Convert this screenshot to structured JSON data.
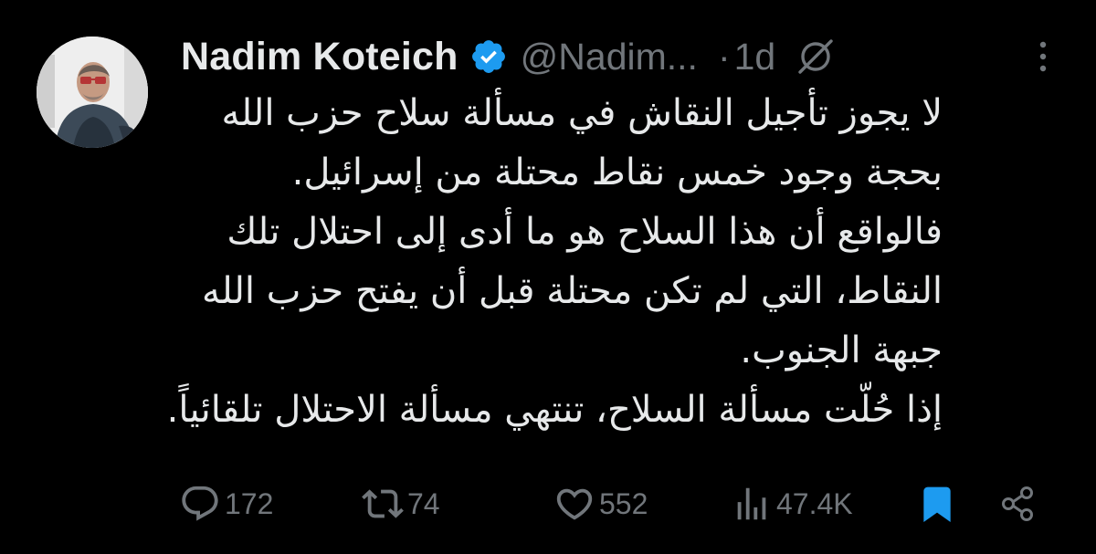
{
  "tweet": {
    "author_name": "Nadim Koteich",
    "handle": "@Nadim...",
    "separator": "·",
    "time": "1d",
    "verified_icon": "verified-badge-icon",
    "colors": {
      "background": "#000000",
      "text": "#e7e9ea",
      "muted": "#71767b",
      "verified": "#1d9bf0",
      "bookmark": "#1d9bf0"
    },
    "body_lines": [
      "لا يجوز تأجيل النقاش في مسألة سلاح حزب الله",
      "بحجة وجود خمس نقاط محتلة من إسرائيل.",
      "فالواقع أن هذا السلاح هو ما أدى إلى احتلال تلك",
      "النقاط، التي لم تكن محتلة قبل أن يفتح حزب الله",
      "جبهة الجنوب.",
      "إذا حُلّت مسألة السلاح، تنتهي مسألة الاحتلال تلقائياً."
    ],
    "actions": {
      "replies": "172",
      "reposts": "74",
      "likes": "552",
      "views": "47.4K"
    }
  }
}
